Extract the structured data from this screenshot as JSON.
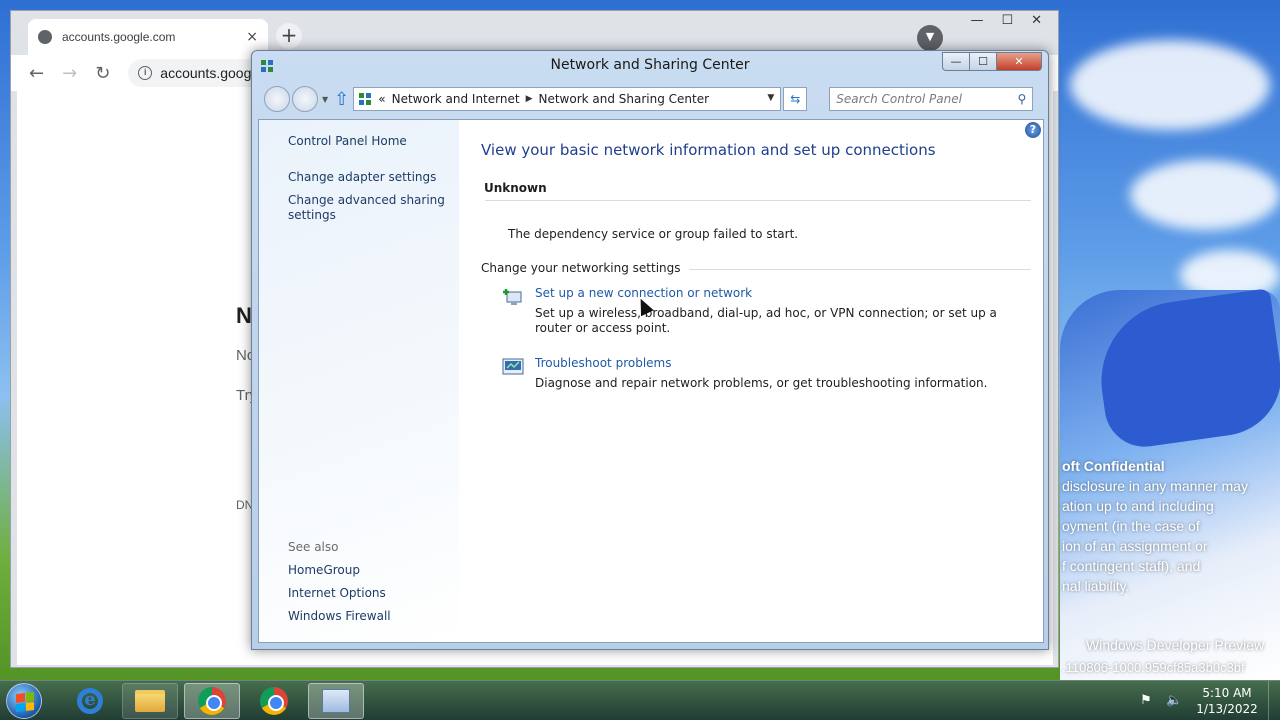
{
  "colors": {
    "link": "#1e5aa8",
    "title_blue": "#1e3f8f",
    "accent_close": "#c4402a"
  },
  "desktop": {
    "watermark": {
      "title": "oft Confidential",
      "lines": [
        "disclosure in any manner may",
        "ation up to and including",
        "oyment (in the case of",
        "ion of an assignment or",
        "f contingent staff), and",
        "nal liability."
      ]
    },
    "dev_preview": "Windows Developer Preview",
    "build": ".110806-1000.959cf85a3b0c3bf"
  },
  "chrome": {
    "tab_title": "accounts.google.com",
    "tab_close": "×",
    "new_tab": "+",
    "caption": {
      "min": "—",
      "max": "☐",
      "close": "✕"
    },
    "profile": "▼",
    "back": "←",
    "forward": "→",
    "reload": "↻",
    "info": "i",
    "url": "accounts.goog",
    "page_fragments": {
      "frag1": "N",
      "frag2": "Nc",
      "frag3": "Try",
      "frag4": "DN"
    }
  },
  "window": {
    "title": "Network and Sharing Center",
    "caption": {
      "min": "—",
      "max": "☐",
      "close": "✕"
    },
    "address": {
      "prefix": "«",
      "crumb1": "Network and Internet",
      "sep": "▶",
      "crumb2": "Network and Sharing Center",
      "dropdown": "▼"
    },
    "refresh": "⇆",
    "search_placeholder": "Search Control Panel",
    "search_icon": "⚲"
  },
  "sidebar": {
    "control_panel_home": "Control Panel Home",
    "change_adapter": "Change adapter settings",
    "change_advanced": "Change advanced sharing settings",
    "see_also": "See also",
    "homegroup": "HomeGroup",
    "internet_options": "Internet Options",
    "windows_firewall": "Windows Firewall"
  },
  "main": {
    "help": "?",
    "title": "View your basic network information and set up connections",
    "network_name": "Unknown",
    "error_message": "The dependency service or group failed to start.",
    "section_heading": "Change your networking settings",
    "tasks": [
      {
        "link": "Set up a new connection or network",
        "description": "Set up a wireless, broadband, dial-up, ad hoc, or VPN connection; or set up a router or access point.",
        "icon": "new-connection-icon"
      },
      {
        "link": "Troubleshoot problems",
        "description": "Diagnose and repair network problems, or get troubleshooting information.",
        "icon": "troubleshoot-icon"
      }
    ]
  },
  "taskbar": {
    "ie_glyph": "e",
    "tray_network": "⚑",
    "tray_volume": "🔈",
    "time": "5:10 AM",
    "date": "1/13/2022"
  }
}
